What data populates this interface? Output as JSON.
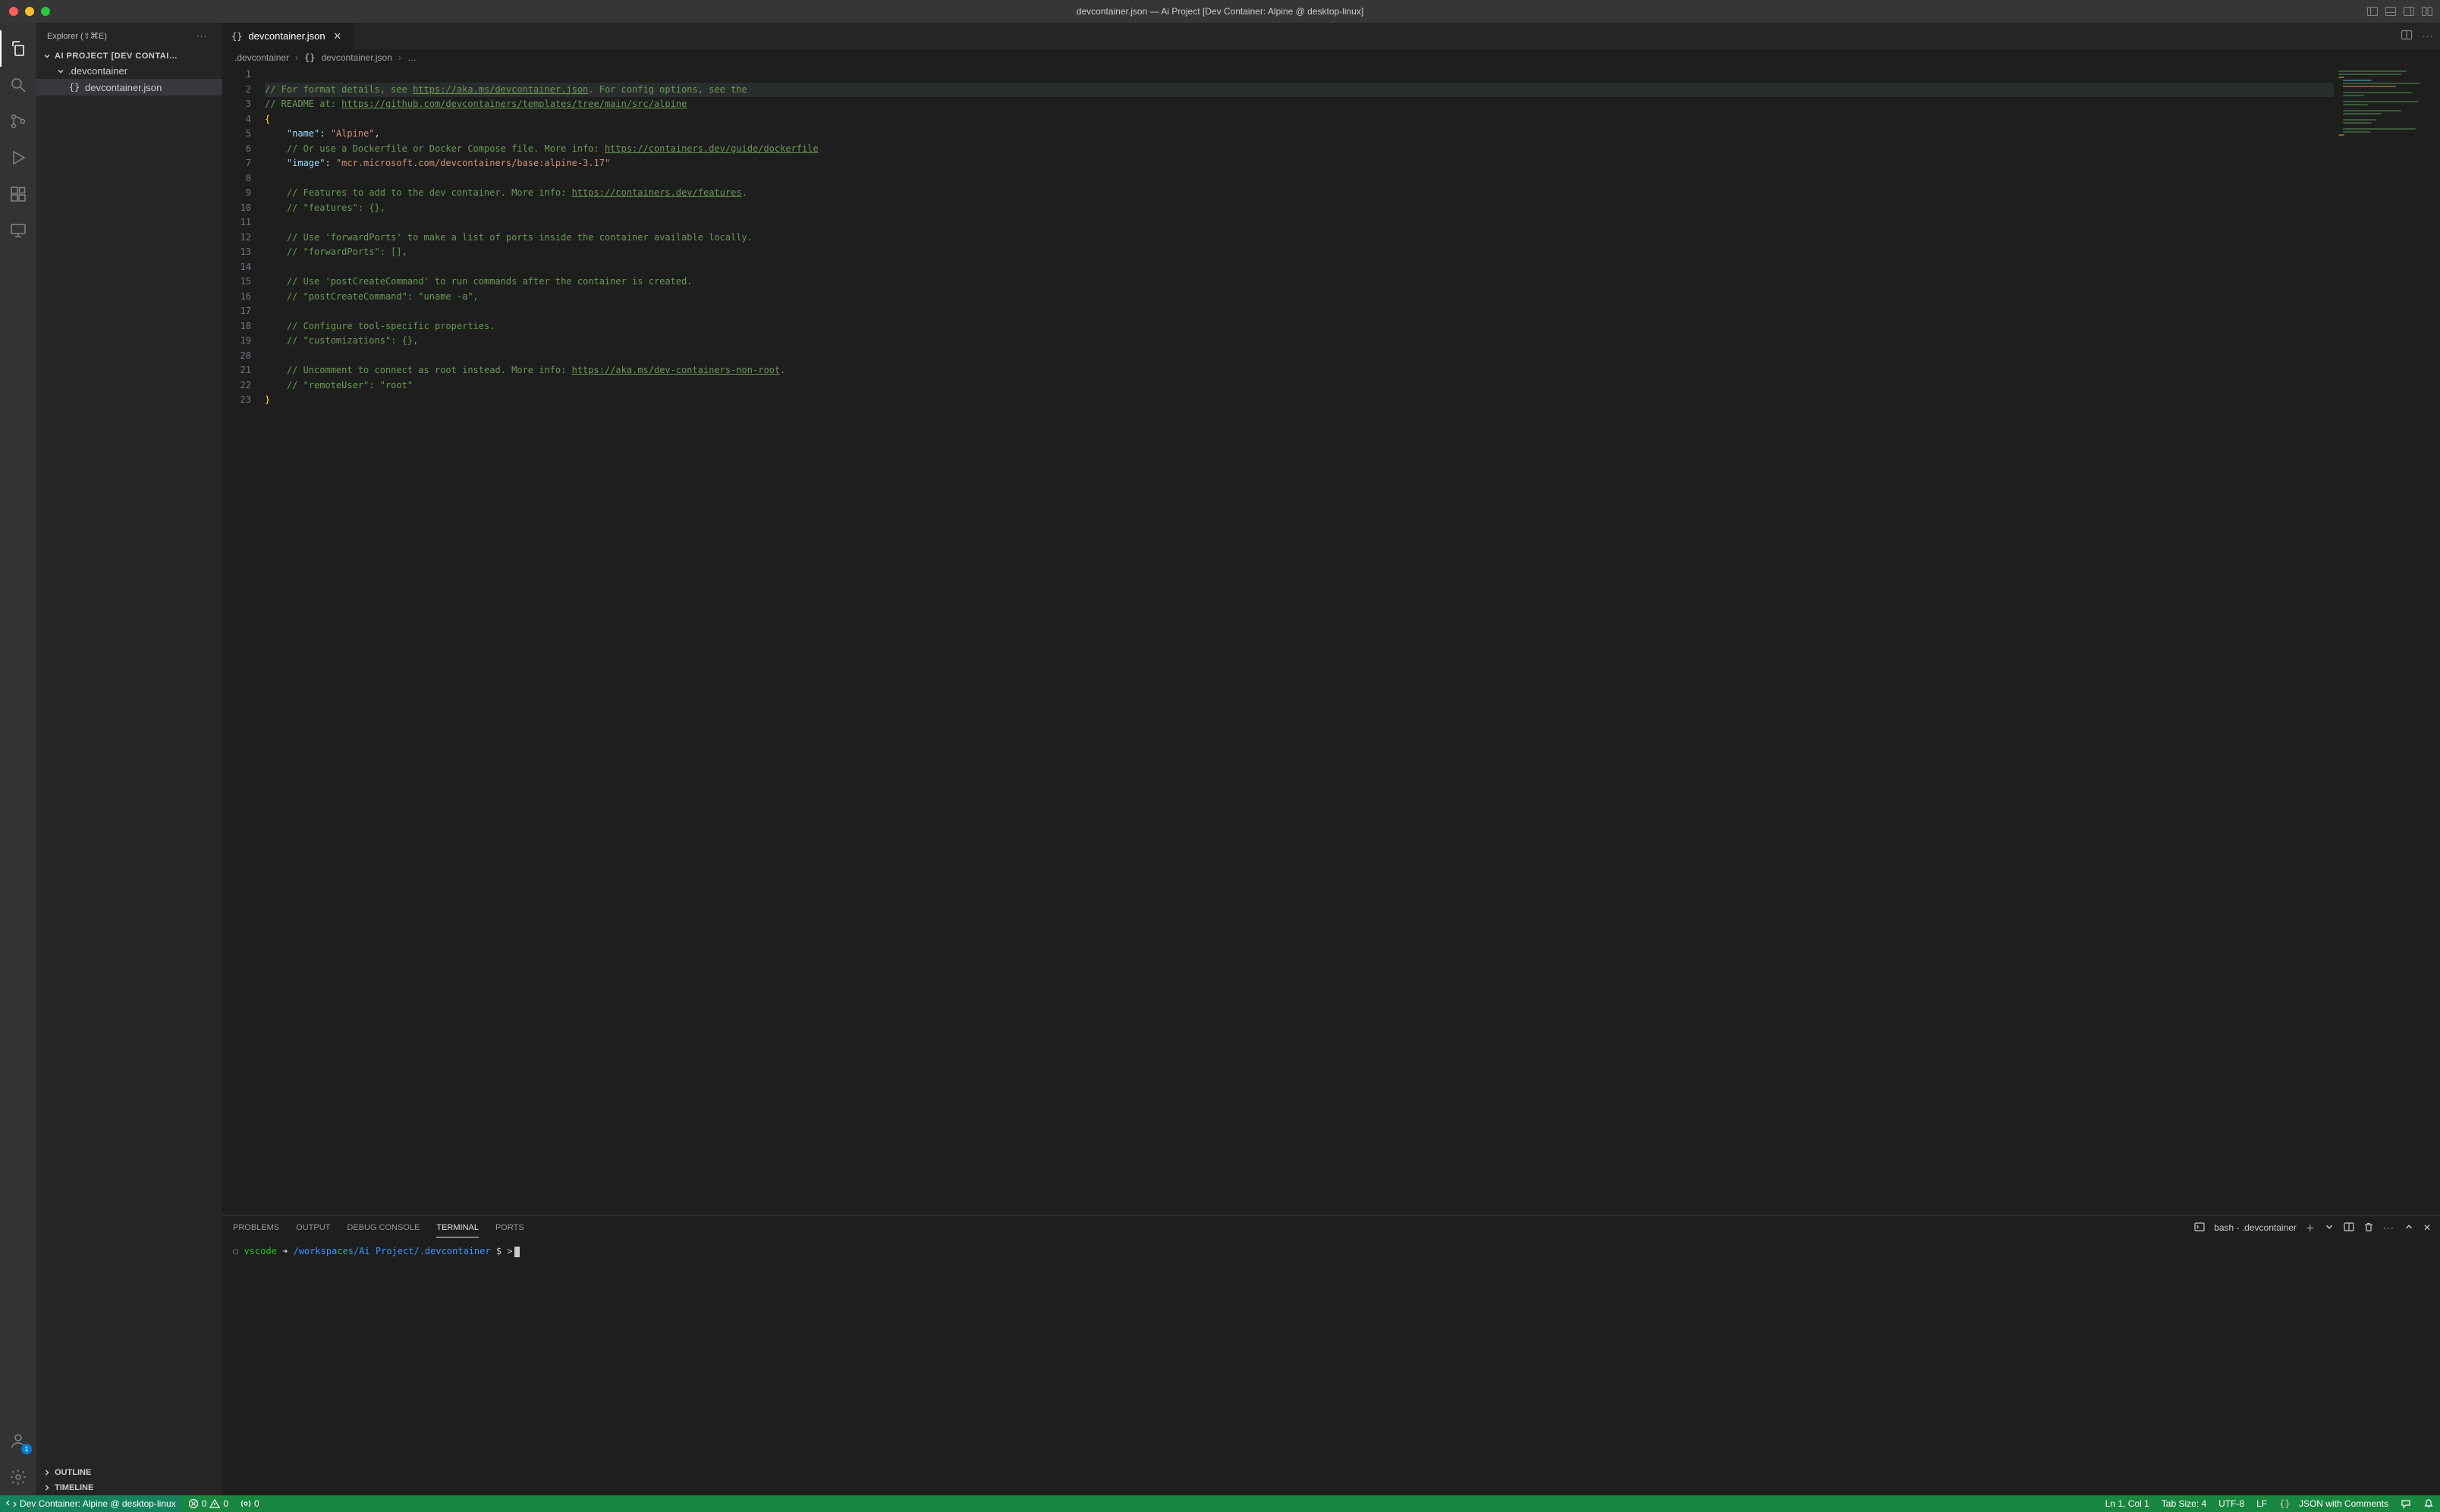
{
  "window": {
    "title": "devcontainer.json — Ai Project [Dev Container: Alpine @ desktop-linux]"
  },
  "sidebar": {
    "header": "Explorer (⇧⌘E)",
    "project": "AI PROJECT [DEV CONTAI…",
    "folder": ".devcontainer",
    "file": "devcontainer.json",
    "outline": "OUTLINE",
    "timeline": "TIMELINE"
  },
  "tab": {
    "name": "devcontainer.json"
  },
  "breadcrumb": {
    "folder": ".devcontainer",
    "file": "devcontainer.json",
    "tail": "…"
  },
  "code": {
    "l1a": "// For format details, see ",
    "l1b": "https://aka.ms/devcontainer.json",
    "l1c": ". For config options, see the",
    "l2a": "// README at: ",
    "l2b": "https://github.com/devcontainers/templates/tree/main/src/alpine",
    "l3": "{",
    "l4a": "\"name\"",
    "l4b": ": ",
    "l4c": "\"Alpine\"",
    "l4d": ",",
    "l5a": "// Or use a Dockerfile or Docker Compose file. More info: ",
    "l5b": "https://containers.dev/guide/dockerfile",
    "l6a": "\"image\"",
    "l6b": ": ",
    "l6c": "\"mcr.microsoft.com/devcontainers/base:alpine-3.17\"",
    "l8a": "// Features to add to the dev container. More info: ",
    "l8b": "https://containers.dev/features",
    "l8c": ".",
    "l9": "// \"features\": {},",
    "l11": "// Use 'forwardPorts' to make a list of ports inside the container available locally.",
    "l12": "// \"forwardPorts\": [],",
    "l14": "// Use 'postCreateCommand' to run commands after the container is created.",
    "l15": "// \"postCreateCommand\": \"uname -a\",",
    "l17": "// Configure tool-specific properties.",
    "l18": "// \"customizations\": {},",
    "l20a": "// Uncomment to connect as root instead. More info: ",
    "l20b": "https://aka.ms/dev-containers-non-root",
    "l20c": ".",
    "l21": "// \"remoteUser\": \"root\"",
    "l22": "}"
  },
  "lines": [
    "1",
    "2",
    "3",
    "4",
    "5",
    "6",
    "7",
    "8",
    "9",
    "10",
    "11",
    "12",
    "13",
    "14",
    "15",
    "16",
    "17",
    "18",
    "19",
    "20",
    "21",
    "22",
    "23"
  ],
  "panel": {
    "tabs": {
      "problems": "PROBLEMS",
      "output": "OUTPUT",
      "debug": "DEBUG CONSOLE",
      "terminal": "TERMINAL",
      "ports": "PORTS"
    },
    "termlabel": "bash - .devcontainer",
    "term": {
      "user": "vscode",
      "arrow": "➜",
      "path": "/workspaces/Ai Project/.devcontainer",
      "dollar": "$",
      "ch": ">"
    }
  },
  "status": {
    "remote": "Dev Container: Alpine @ desktop-linux",
    "err": "0",
    "warn": "0",
    "ports": "0",
    "lncol": "Ln 1, Col 1",
    "tabsize": "Tab Size: 4",
    "encoding": "UTF-8",
    "eol": "LF",
    "lang": "JSON with Comments"
  },
  "accounts_badge": "1"
}
